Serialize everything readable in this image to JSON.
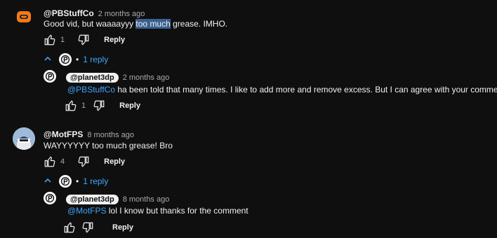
{
  "comments": [
    {
      "handle": "@PBStuffCo",
      "time": "2 months ago",
      "text_before": "Good vid, but waaaayyy ",
      "text_highlight": "too much",
      "text_after": " grease.   IMHO.",
      "likes": "1",
      "reply_label": "Reply",
      "replies_toggle": "1 reply",
      "reply": {
        "handle": "@planet3dp",
        "time": "2 months ago",
        "mention": "@PBStuffCo",
        "text": " ha been told that many times. I like to add more and remove excess. But I can agree with your comment. 👍",
        "likes": "1",
        "reply_label": "Reply"
      }
    },
    {
      "handle": "@MotFPS",
      "time": "8 months ago",
      "text": "WAYYYYYY too much grease! Bro",
      "likes": "4",
      "reply_label": "Reply",
      "replies_toggle": "1 reply",
      "reply": {
        "handle": "@planet3dp",
        "time": "8 months ago",
        "mention": "@MotFPS",
        "text": " lol I know but thanks for the comment",
        "likes": "",
        "reply_label": "Reply"
      }
    }
  ],
  "colors": {
    "background": "#0f0f0f",
    "mention": "#3ea6ff",
    "highlight": "#3a5f8f"
  }
}
